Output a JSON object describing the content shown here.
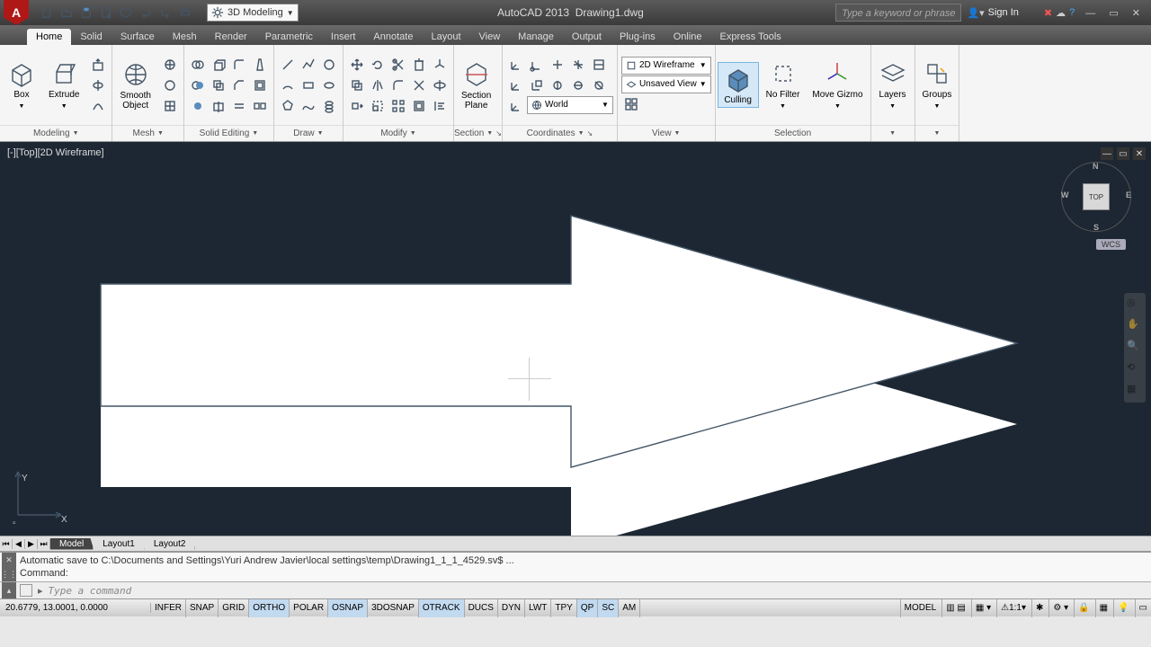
{
  "app": {
    "title": "AutoCAD 2013",
    "doc": "Drawing1.dwg",
    "workspace": "3D Modeling",
    "searchPlaceholder": "Type a keyword or phrase",
    "signin": "Sign In"
  },
  "tabs": [
    "Home",
    "Solid",
    "Surface",
    "Mesh",
    "Render",
    "Parametric",
    "Insert",
    "Annotate",
    "Layout",
    "View",
    "Manage",
    "Output",
    "Plug-ins",
    "Online",
    "Express Tools"
  ],
  "activeTab": "Home",
  "panels": {
    "modeling": {
      "title": "Modeling",
      "box": "Box",
      "extrude": "Extrude",
      "smooth": "Smooth\nObject"
    },
    "mesh": {
      "title": "Mesh"
    },
    "solidEditing": {
      "title": "Solid Editing"
    },
    "draw": {
      "title": "Draw"
    },
    "modify": {
      "title": "Modify"
    },
    "section": {
      "title": "Section",
      "plane": "Section\nPlane"
    },
    "coordinates": {
      "title": "Coordinates",
      "world": "World"
    },
    "view": {
      "title": "View",
      "visualStyle": "2D Wireframe",
      "savedView": "Unsaved View"
    },
    "selection": {
      "title": "Selection",
      "culling": "Culling",
      "nofilter": "No Filter",
      "gizmo": "Move Gizmo"
    },
    "layers": {
      "title": "",
      "label": "Layers"
    },
    "groups": {
      "title": "",
      "label": "Groups"
    }
  },
  "viewport": {
    "label": "[-][Top][2D Wireframe]",
    "cube": "TOP",
    "wcs": "WCS",
    "dirs": {
      "n": "N",
      "s": "S",
      "e": "E",
      "w": "W"
    }
  },
  "layoutTabs": [
    "Model",
    "Layout1",
    "Layout2"
  ],
  "cmd": {
    "history1": "Automatic save to C:\\Documents and Settings\\Yuri Andrew Javier\\local settings\\temp\\Drawing1_1_1_4529.sv$ ...",
    "history2": "Command:",
    "placeholder": "Type a command"
  },
  "status": {
    "coords": "20.6779, 13.0001, 0.0000",
    "toggles": [
      {
        "l": "INFER",
        "on": false
      },
      {
        "l": "SNAP",
        "on": false
      },
      {
        "l": "GRID",
        "on": false
      },
      {
        "l": "ORTHO",
        "on": true
      },
      {
        "l": "POLAR",
        "on": false
      },
      {
        "l": "OSNAP",
        "on": true
      },
      {
        "l": "3DOSNAP",
        "on": false
      },
      {
        "l": "OTRACK",
        "on": true
      },
      {
        "l": "DUCS",
        "on": false
      },
      {
        "l": "DYN",
        "on": false
      },
      {
        "l": "LWT",
        "on": false
      },
      {
        "l": "TPY",
        "on": false
      },
      {
        "l": "QP",
        "on": true
      },
      {
        "l": "SC",
        "on": true
      },
      {
        "l": "AM",
        "on": false
      }
    ],
    "model": "MODEL",
    "scale": "1:1"
  }
}
